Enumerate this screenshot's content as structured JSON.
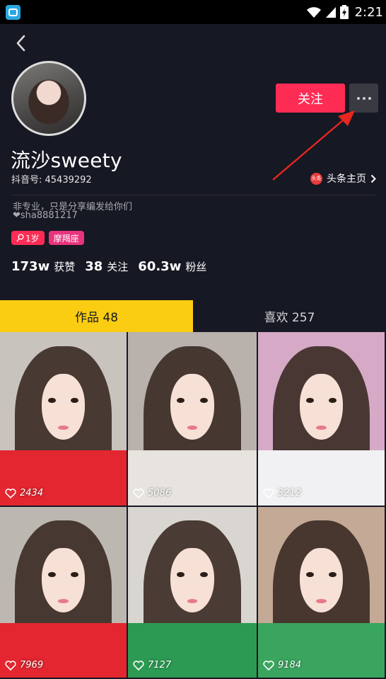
{
  "status_bar": {
    "time": "2:21",
    "icons": [
      "app-icon",
      "wifi-icon",
      "signal-icon",
      "battery-icon"
    ]
  },
  "header": {
    "back_icon": "chevron-left-icon",
    "follow_label": "关注",
    "more_icon": "more-icon"
  },
  "profile": {
    "nickname": "流沙sweety",
    "douyin_id": "抖音号: 45439292",
    "toutiao_logo_text": "头条",
    "toutiao_label": "头条主页",
    "bio_line1": "非专业，只是分享编发给你们",
    "bio_line2": "❤sha8881217",
    "tags": [
      {
        "label": "1岁",
        "icon": "female-icon"
      },
      {
        "label": "摩羯座"
      }
    ],
    "stats": [
      {
        "num": "173w",
        "label": "获赞"
      },
      {
        "num": "38",
        "label": "关注"
      },
      {
        "num": "60.3w",
        "label": "粉丝"
      }
    ]
  },
  "tabs": [
    {
      "label": "作品 48",
      "active": true
    },
    {
      "label": "喜欢 257",
      "active": false
    }
  ],
  "videos": [
    {
      "likes": "2434",
      "bg": "#c9c3bd",
      "shirt": "#e3262f"
    },
    {
      "likes": "5086",
      "bg": "#b9b2ac",
      "shirt": "#e7e3df"
    },
    {
      "likes": "3212",
      "bg": "#d6a9c7",
      "shirt": "#f1f1f3"
    },
    {
      "likes": "7969",
      "bg": "#bdb7b2",
      "shirt": "#e3262f"
    },
    {
      "likes": "7127",
      "bg": "#d9d6d2",
      "shirt": "#2c9a52"
    },
    {
      "likes": "9184",
      "bg": "#c4a996",
      "shirt": "#3aa55e"
    }
  ],
  "colors": {
    "background": "#161823",
    "accent": "#fe2c55",
    "tab_active": "#facd13",
    "annotation": "#e8261f"
  }
}
